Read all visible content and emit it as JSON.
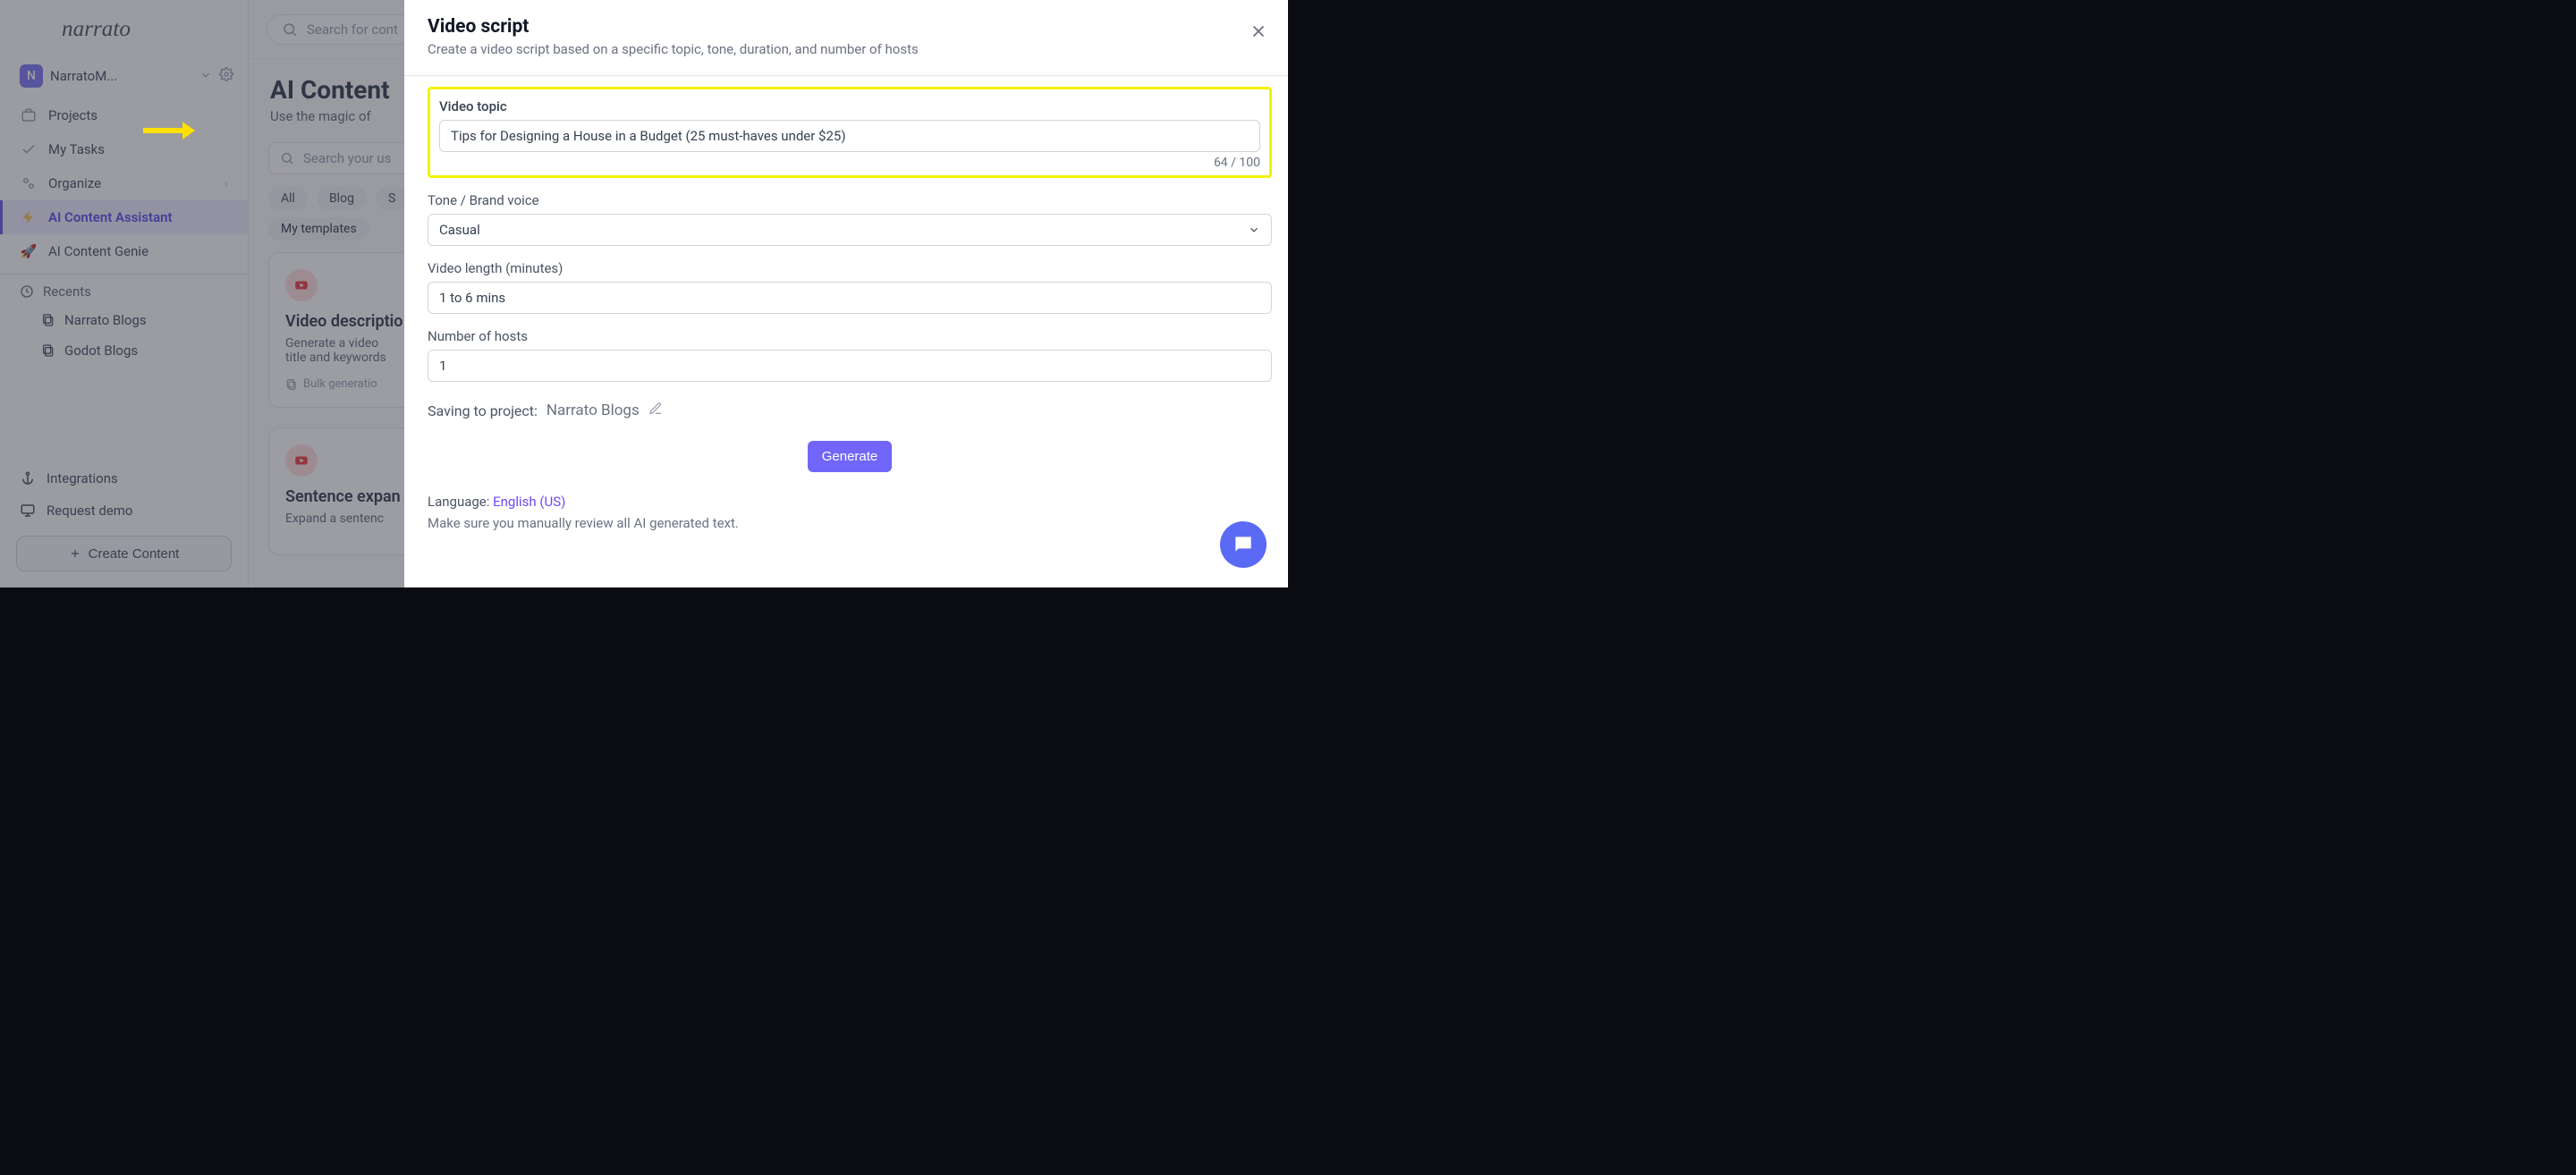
{
  "workspace": {
    "initial": "N",
    "name": "NarratoM..."
  },
  "nav": {
    "projects": "Projects",
    "tasks": "My Tasks",
    "organize": "Organize",
    "assistant": "AI Content Assistant",
    "genie": "AI Content Genie"
  },
  "recents": {
    "header": "Recents",
    "items": [
      "Narrato Blogs",
      "Godot Blogs"
    ]
  },
  "footer": {
    "integrations": "Integrations",
    "request_demo": "Request demo",
    "create_content": "Create Content"
  },
  "topbar": {
    "search_placeholder": "Search for cont"
  },
  "page": {
    "title": "AI Content",
    "subtitle": "Use the magic of",
    "usecase_search_placeholder": "Search your us",
    "chips": [
      "All",
      "Blog",
      "S"
    ],
    "templates_chip": "My templates"
  },
  "card1": {
    "title": "Video descriptio",
    "desc_line1": "Generate a video",
    "desc_line2": "title and keywords",
    "foot": "Bulk generatio"
  },
  "card2": {
    "title": "Sentence expan",
    "desc": "Expand a sentenc"
  },
  "modal": {
    "title": "Video script",
    "subtitle": "Create a video script based on a specific topic, tone, duration, and number of hosts",
    "labels": {
      "topic": "Video topic",
      "tone": "Tone / Brand voice",
      "length": "Video length (minutes)",
      "hosts": "Number of hosts",
      "saving_to": "Saving to project:"
    },
    "values": {
      "topic": "Tips for Designing a House in a Budget (25 must-haves under $25)",
      "tone": "Casual",
      "length": "1 to 6 mins",
      "hosts": "1",
      "project": "Narrato Blogs"
    },
    "counter": "64 / 100",
    "generate": "Generate",
    "language_label": "Language: ",
    "language_value": "English (US)",
    "tip": "Make sure you manually review all AI generated text."
  }
}
